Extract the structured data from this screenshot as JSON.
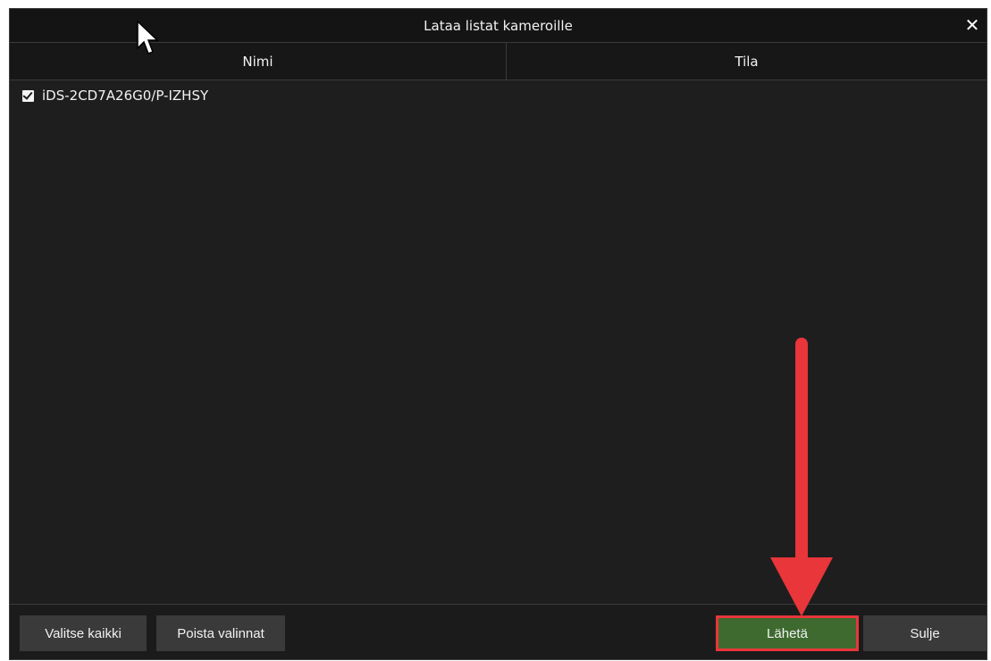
{
  "dialog": {
    "title": "Lataa listat kameroille",
    "close_icon": "close-icon"
  },
  "table": {
    "columns": [
      "Nimi",
      "Tila"
    ],
    "rows": [
      {
        "name": "iDS-2CD7A26G0/P-IZHSY",
        "status": "",
        "checked": true
      }
    ]
  },
  "footer": {
    "select_all_label": "Valitse kaikki",
    "clear_selection_label": "Poista valinnat",
    "send_label": "Lähetä",
    "close_label": "Sulje"
  },
  "colors": {
    "dialog_bg": "#1e1e1e",
    "send_button": "#3e6a30",
    "highlight": "#e8363a"
  }
}
